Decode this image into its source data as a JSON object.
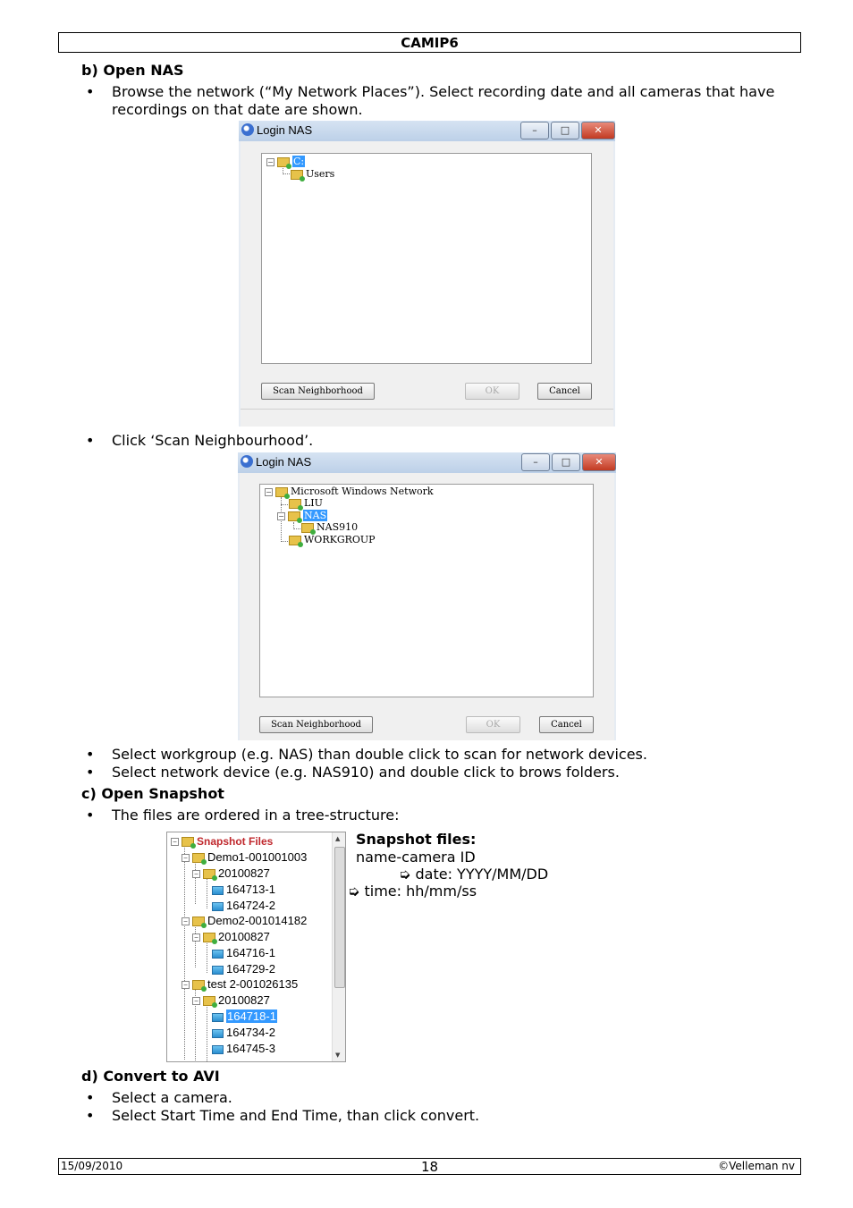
{
  "header": {
    "title": "CAMIP6"
  },
  "sectionB": {
    "heading": "b) Open NAS",
    "bullet1_line1": "Browse the network (“My Network Places”). Select recording date and all cameras that have",
    "bullet1_line2": "recordings on that date are shown.",
    "bullet2": "Click ‘Scan Neighbourhood’.",
    "bullet3": "Select workgroup (e.g. NAS) than double click to scan for network devices.",
    "bullet4": "Select network device (e.g. NAS910) and double click to brows folders."
  },
  "window1": {
    "title": "Login NAS",
    "tree": [
      {
        "label": "C:",
        "selected": true
      },
      {
        "label": "Users"
      }
    ],
    "scan_button": "Scan Neighborhood",
    "ok_button": "OK",
    "cancel_button": "Cancel"
  },
  "window2": {
    "title": "Login NAS",
    "tree": [
      {
        "label": "Microsoft Windows Network"
      },
      {
        "label": "LIU"
      },
      {
        "label": "NAS",
        "selected": true
      },
      {
        "label": "NAS910"
      },
      {
        "label": "WORKGROUP"
      }
    ],
    "scan_button": "Scan Neighborhood",
    "ok_button": "OK",
    "cancel_button": "Cancel"
  },
  "sectionC": {
    "heading": "c) Open Snapshot",
    "bullet1": "The files are ordered in a tree-structure:",
    "snapshot_tree": [
      "Snapshot Files",
      "Demo1-001001003",
      "20100827",
      "164713-1",
      "164724-2",
      "Demo2-001014182",
      "20100827",
      "164716-1",
      "164729-2",
      "test 2-001026135",
      "20100827",
      "164718-1",
      "164734-2",
      "164745-3"
    ],
    "desc_title": "Snapshot files:",
    "desc_line1": "name-camera ID",
    "desc_line2": "date: YYYY/MM/DD",
    "desc_line3": "time: hh/mm/ss"
  },
  "sectionD": {
    "heading": "d) Convert to AVI",
    "bullet1": "Select a camera.",
    "bullet2": "Select Start Time and End Time, than click convert."
  },
  "footer": {
    "date": "15/09/2010",
    "page": "18",
    "copyright": "©Velleman nv"
  }
}
